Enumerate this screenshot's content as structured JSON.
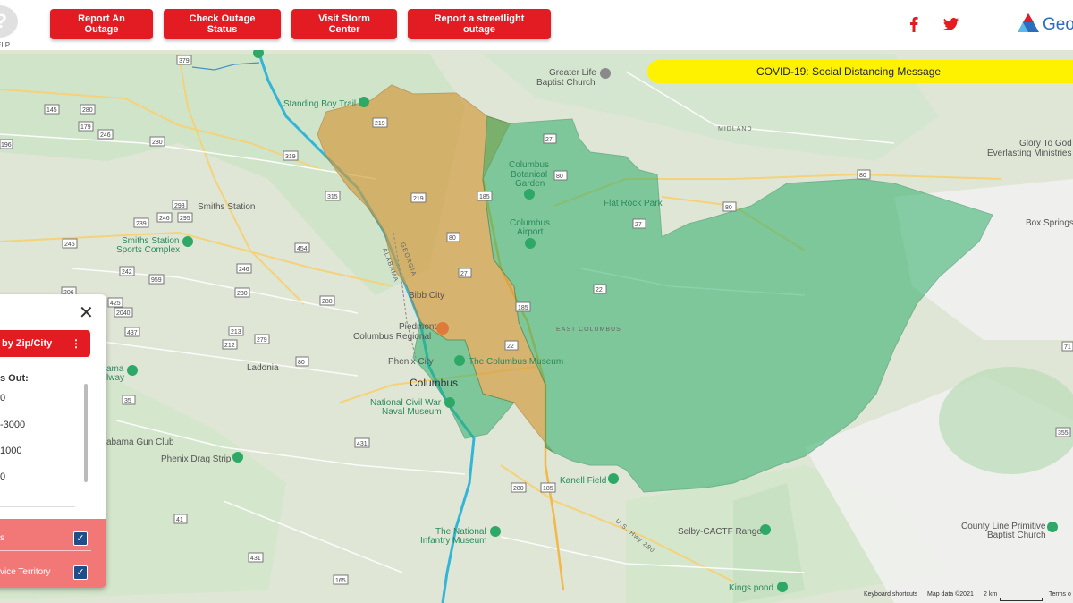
{
  "header": {
    "help_label": "ELP",
    "help_glyph": "?",
    "buttons": [
      {
        "label": "Report An Outage"
      },
      {
        "label": "Check Outage Status"
      },
      {
        "label": "Visit Storm Center"
      },
      {
        "label": "Report a streetlight outage"
      }
    ],
    "social": [
      "facebook-icon",
      "twitter-icon"
    ],
    "logo_text": "Geo"
  },
  "banner": {
    "text": "COVID-19: Social Distancing Message"
  },
  "colors": {
    "brand_red": "#e31b23",
    "banner_yellow": "#fff200",
    "region_orange": "#d49a3a",
    "region_green": "#2fae6a",
    "layers_bg": "#f27878"
  },
  "panel": {
    "close": "✕",
    "filter_label": "by Zip/City",
    "filter_menu": "⋮",
    "legend_title": "s Out:",
    "legend_items": [
      "0",
      "-3000",
      "1000",
      "0"
    ],
    "layers": [
      {
        "label": "s",
        "checked": "✓"
      },
      {
        "label": "vice Territory",
        "checked": "✓"
      }
    ]
  },
  "map_labels": {
    "places": [
      "Standing Boy Trail",
      "Greater Life",
      "Baptist Church",
      "Columbus",
      "Botanical",
      "Garden",
      "Flat Rock Park",
      "Columbus",
      "Airport",
      "Smiths Station",
      "Smiths Station",
      "Sports Complex",
      "Glory To God",
      "Everlasting Ministries",
      "Box Springs",
      "Bibb City",
      "Piedmont",
      "Columbus Regional",
      "Phenix City",
      "The Columbus Museum",
      "Columbus",
      "National Civil War",
      "Naval Museum",
      "Ladonia",
      "ama",
      "lway",
      "abama Gun Club",
      "Phenix Drag Strip",
      "Kanell Field",
      "The National",
      "Infantry Museum",
      "Selby-CACTF Range",
      "County Line Primitive",
      "Baptist Church",
      "Kings pond"
    ],
    "small": [
      "MIDLAND",
      "EAST COLUMBUS",
      "GEORGIA",
      "ALABAMA",
      "U.S. Hwy 280"
    ],
    "shields": [
      "379",
      "145",
      "280",
      "179",
      "246",
      "196",
      "319",
      "280",
      "219",
      "27",
      "80",
      "293",
      "246",
      "295",
      "239",
      "315",
      "219",
      "185",
      "80",
      "27",
      "245",
      "454",
      "242",
      "959",
      "246",
      "230",
      "206",
      "425",
      "2040",
      "280",
      "437",
      "213",
      "212",
      "279",
      "80",
      "22",
      "185",
      "27",
      "80",
      "80",
      "22",
      "71",
      "35",
      "280",
      "431",
      "185",
      "355",
      "41",
      "431",
      "165"
    ]
  },
  "attribution": {
    "shortcuts": "Keyboard shortcuts",
    "data": "Map data ©2021",
    "scale": "2 km",
    "terms": "Terms o"
  }
}
